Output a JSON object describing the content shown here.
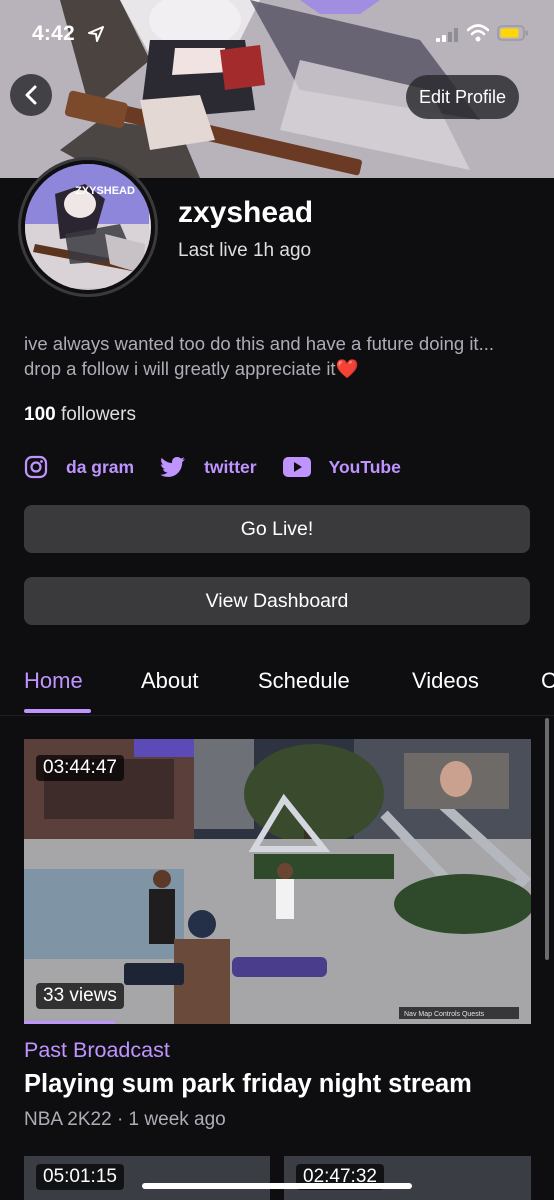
{
  "status_bar": {
    "time": "4:42"
  },
  "banner": {
    "edit_label": "Edit Profile"
  },
  "profile": {
    "username": "zxyshead",
    "last_live": "Last live 1h ago",
    "bio": "ive always wanted too do this and have a future doing it... drop a follow i will greatly appreciate it",
    "bio_emoji": "❤️",
    "followers_count": "100",
    "followers_label": "followers",
    "avatar_text": "ZXYSHEAD"
  },
  "socials": [
    {
      "label": "da gram",
      "icon": "instagram-icon"
    },
    {
      "label": "twitter",
      "icon": "twitter-icon"
    },
    {
      "label": "YouTube",
      "icon": "youtube-icon"
    }
  ],
  "buttons": {
    "go_live": "Go Live!",
    "dashboard": "View Dashboard"
  },
  "tabs": [
    {
      "label": "Home",
      "active": true
    },
    {
      "label": "About"
    },
    {
      "label": "Schedule"
    },
    {
      "label": "Videos"
    },
    {
      "label": "C"
    }
  ],
  "video": {
    "duration": "03:44:47",
    "views": "33 views",
    "type": "Past Broadcast",
    "title": "Playing sum park friday night stream",
    "meta": "NBA 2K22 · 1 week ago",
    "hud_text": "Nav  Map  Controls  Quests",
    "progress_fraction": 0.18
  },
  "next_videos": [
    {
      "duration": "05:01:15"
    },
    {
      "duration": "02:47:32"
    }
  ],
  "colors": {
    "accent": "#bf94ff",
    "background": "#0e0e10",
    "button": "#3a3a3d",
    "heart": "#e03a3a"
  }
}
